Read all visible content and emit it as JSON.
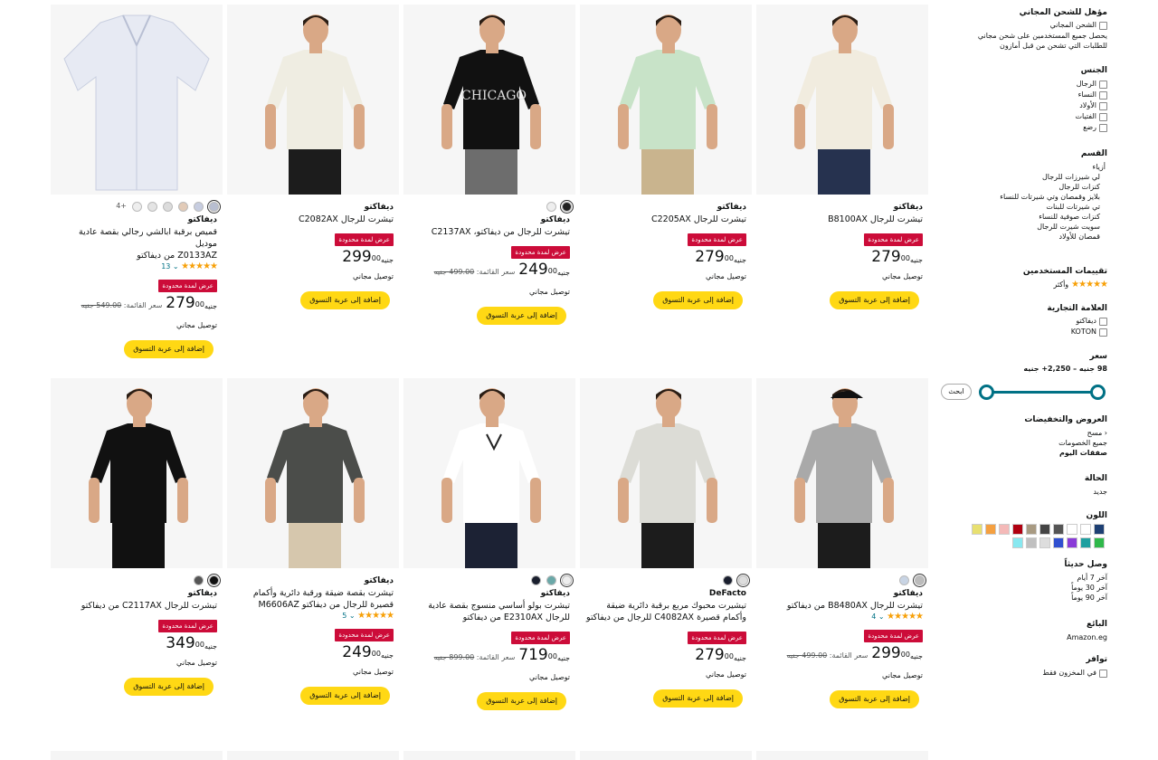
{
  "sidebar": {
    "free_shipping": {
      "heading": "مؤهل للشحن المجاني",
      "option": "الشحن المجاني",
      "note1": "يحصل جميع المستخدمين على شحن مجاني",
      "note2": "للطلبات التي تشحن من قبل أمازون"
    },
    "gender": {
      "heading": "الجنس",
      "options": [
        "الرجال",
        "النساء",
        "الأولاد",
        "الفتيات",
        "رضع"
      ]
    },
    "department": {
      "heading": "القسم",
      "items": [
        "أزياء",
        "لي شيرزات للرجال",
        "كنزات للرجال",
        "بلايز وقمصان وتي شيرتات للنساء",
        "تي شيرتات للبنات",
        "كنزات صوفية للنساء",
        "سويت شيرت للرجال",
        "قمصان للأولاد"
      ]
    },
    "ratings": {
      "heading": "تقييمات المستخدمين",
      "stars": "★★★★★",
      "label": "وأكثر"
    },
    "brand": {
      "heading": "العلامة التجارية",
      "options": [
        "ديفاكتو",
        "KOTON"
      ]
    },
    "price": {
      "heading": "سعر",
      "range": "98 جنيه – 2,250+ جنيه",
      "go": "ابحث"
    },
    "deals": {
      "heading": "العروض والتخفيضات",
      "items": [
        "مسح",
        "جميع الخصومات"
      ],
      "today": "صفقات اليوم"
    },
    "condition": {
      "heading": "الحالة",
      "value": "جديد"
    },
    "color": {
      "heading": "اللون",
      "swatches_row1": [
        "#1d3f73",
        "#ffffff",
        "#ffffff",
        "#555555",
        "#444444",
        "#a89a82",
        "#b00010",
        "#f4b9b8",
        "#f5a040",
        "#e8e070"
      ],
      "swatches_row2": [
        "#2fb84a",
        "#1f9fa0",
        "#8a3cd8",
        "#3050d0",
        "#dddddd",
        "#c0c0c0",
        "#88e8f0"
      ]
    },
    "new": {
      "heading": "وصل حديثاً",
      "items": [
        "آخر 7 أيام",
        "آخر 30 يوماً",
        "آخر 90 يوماً"
      ]
    },
    "seller": {
      "heading": "البائع",
      "option": "Amazon.eg"
    },
    "availability": {
      "heading": "توافر",
      "option": "في المخزون فقط"
    }
  },
  "products": [
    {
      "brand": "ديفاكتو",
      "title": [
        "تيشرت للرجال B8100AX"
      ],
      "badge": "عرض لمدة محدودة",
      "price_whole": "279",
      "price_frac": "00",
      "currency": "جنيه",
      "delivery": "توصيل مجاني",
      "cart": "إضافة إلى عربة التسوق"
    },
    {
      "brand": "ديفاكتو",
      "title": [
        "تيشرت للرجال C2205AX"
      ],
      "badge": "عرض لمدة محدودة",
      "price_whole": "279",
      "price_frac": "00",
      "currency": "جنيه",
      "delivery": "توصيل مجاني",
      "cart": "إضافة إلى عربة التسوق"
    },
    {
      "brand": "ديفاكتو",
      "title": [
        "تيشرت للرجال من ديفاكتو، C2137AX"
      ],
      "badge": "عرض لمدة محدودة",
      "price_whole": "249",
      "price_frac": "00",
      "currency": "جنيه",
      "was_label": "سعر القائمة:",
      "was_price": "499.00 جنيه",
      "delivery": "توصيل مجاني",
      "cart": "إضافة إلى عربة التسوق",
      "dots": [
        "#222222",
        "#eeeeee"
      ]
    },
    {
      "brand": "ديفاكتو",
      "title": [
        "تيشرت للرجال C2082AX"
      ],
      "badge": "عرض لمدة محدودة",
      "price_whole": "299",
      "price_frac": "00",
      "currency": "جنيه",
      "delivery": "توصيل مجاني",
      "cart": "إضافة إلى عربة التسوق"
    },
    {
      "brand": "ديفاكتو",
      "title": [
        "قميص برقبة ابالشي رجالي بقصة عادية موديل",
        "Z0133AZ من ديفاكتو"
      ],
      "stars": "★★★★★",
      "rating_count": "13",
      "badge": "عرض لمدة محدودة",
      "price_whole": "279",
      "price_frac": "00",
      "currency": "جنيه",
      "was_label": "سعر القائمة:",
      "was_price": "549.00 جنيه",
      "delivery": "توصيل مجاني",
      "cart": "إضافة إلى عربة التسوق",
      "dots": [
        "#b8bed0",
        "#c7cde0",
        "#e2cbb8",
        "#dcdcdc",
        "#e4e4e4",
        "#eeeeee"
      ],
      "more": "+4"
    },
    {
      "brand": "ديفاكتو",
      "title": [
        "تيشرت للرجال B8480AX من ديفاكتو"
      ],
      "stars": "★★★★★",
      "rating_count": "4",
      "badge": "عرض لمدة محدودة",
      "price_whole": "299",
      "price_frac": "00",
      "currency": "جنيه",
      "was_label": "سعر القائمة:",
      "was_price": "499.00 جنيه",
      "delivery": "توصيل مجاني",
      "cart": "إضافة إلى عربة التسوق",
      "dots": [
        "#bbbbbb",
        "#c8d4e4"
      ]
    },
    {
      "brand": "DeFacto",
      "title": [
        "تيشيرت محبوك مربع برقبة دائرية ضيقة",
        "وأكمام قصيرة C4082AX للرجال من ديفاكتو"
      ],
      "badge": "عرض لمدة محدودة",
      "price_whole": "279",
      "price_frac": "00",
      "currency": "جنيه",
      "delivery": "توصيل مجاني",
      "cart": "إضافة إلى عربة التسوق",
      "dots": [
        "#dddddd",
        "#1a1f2e"
      ]
    },
    {
      "brand": "ديفاكتو",
      "title": [
        "تيشرت بولو أساسي منسوج بقصة عادية",
        "للرجال E2310AX من ديفاكتو"
      ],
      "badge": "عرض لمدة محدودة",
      "price_whole": "719",
      "price_frac": "00",
      "currency": "جنيه",
      "was_label": "سعر القائمة:",
      "was_price": "899.00 جنيه",
      "delivery": "توصيل مجاني",
      "cart": "إضافة إلى عربة التسوق",
      "dots": [
        "#eeeeee",
        "#6aa8a8",
        "#1a1f2e"
      ]
    },
    {
      "brand": "ديفاكتو",
      "title": [
        "تيشرت بقصة ضيقة ورقبة دائرية وأكمام",
        "قصيرة للرجال من ديفاكتو M6606AZ"
      ],
      "stars": "★★★★★",
      "rating_count": "5",
      "badge": "عرض لمدة محدودة",
      "price_whole": "249",
      "price_frac": "00",
      "currency": "جنيه",
      "delivery": "توصيل مجاني",
      "cart": "إضافة إلى عربة التسوق"
    },
    {
      "brand": "ديفاكتو",
      "title": [
        "تيشرت للرجال C2117AX من ديفاكتو"
      ],
      "badge": "عرض لمدة محدودة",
      "price_whole": "349",
      "price_frac": "00",
      "currency": "جنيه",
      "delivery": "توصيل مجاني",
      "cart": "إضافة إلى عربة التسوق",
      "dots": [
        "#111111",
        "#555555"
      ]
    }
  ]
}
